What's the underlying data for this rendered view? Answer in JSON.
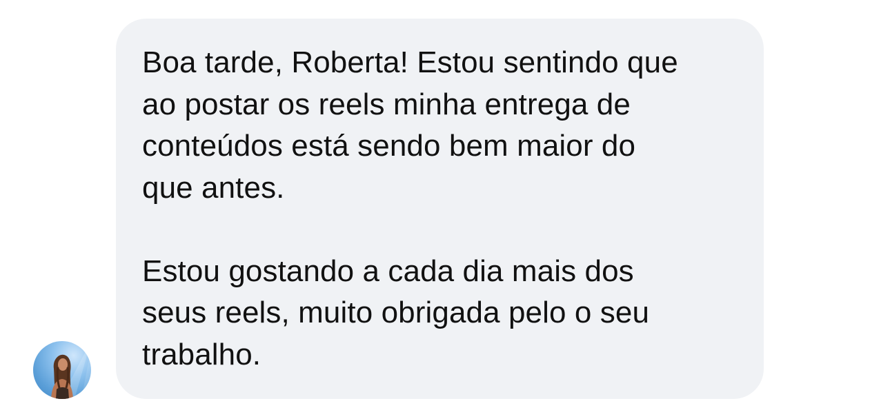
{
  "conversation": {
    "message": {
      "paragraphs": [
        "Boa tarde, Roberta! Estou sentindo que ao postar os reels minha entrega de conteúdos está sendo bem maior do que antes.",
        "Estou gostando a cada dia mais dos seus reels, muito obrigada pelo o seu trabalho."
      ],
      "lines": [
        "Boa tarde, Roberta! Estou sentindo que",
        "ao postar os reels minha entrega de",
        "conteúdos está sendo bem maior do",
        "que antes.",
        "Estou gostando a cada dia mais dos",
        "seus reels, muito obrigada pelo o seu",
        "trabalho."
      ]
    },
    "sender": {
      "avatar_icon": "profile-photo-avatar"
    }
  },
  "colors": {
    "bubble_background": "#f0f2f5",
    "text": "#111111",
    "page_background": "#ffffff",
    "avatar_sky": "#5b9fd8"
  }
}
